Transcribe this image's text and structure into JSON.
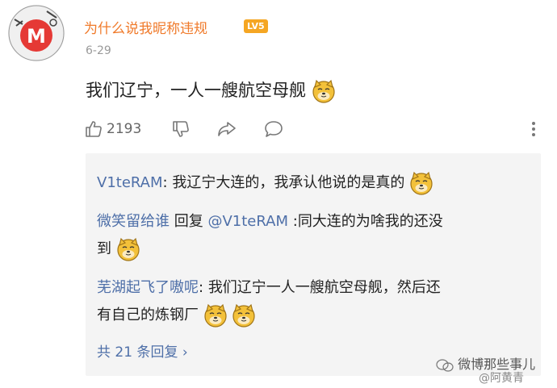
{
  "post": {
    "username": "为什么说我昵称违规",
    "level_badge": "LV5",
    "date": "6-29",
    "text": "我们辽宁，一人一艘航空母舰",
    "emoji_icon": "doge-emoji"
  },
  "actions": {
    "like_count": "2193",
    "icons": [
      "thumbs-up-icon",
      "thumbs-down-icon",
      "share-icon",
      "comment-icon",
      "more-icon"
    ]
  },
  "replies": [
    {
      "user": "V1teRAM",
      "separator": ":",
      "text": "我辽宁大连的，我承认他说的是真的",
      "emojis": 1
    },
    {
      "user": "微笑留给谁",
      "reply_word": "回复",
      "target": "@V1teRAM",
      "separator": ":",
      "text_line1": "同大连的为啥我的还没",
      "text_line2": "到",
      "emojis": 1
    },
    {
      "user": "芜湖起飞了嗷呢",
      "separator": ":",
      "text_line1": "我们辽宁一人一艘航空母舰，然后还",
      "text_line2": "有自己的炼钢厂",
      "emojis": 2
    }
  ],
  "view_all": "共 21 条回复 ›",
  "watermark": {
    "line1": "微博那些事儿",
    "line2": "@阿黄青"
  },
  "colors": {
    "username": "#f07a2a",
    "link_blue": "#4e6fa8",
    "reply_bg": "#f4f4f4",
    "badge": "#f5a623"
  }
}
